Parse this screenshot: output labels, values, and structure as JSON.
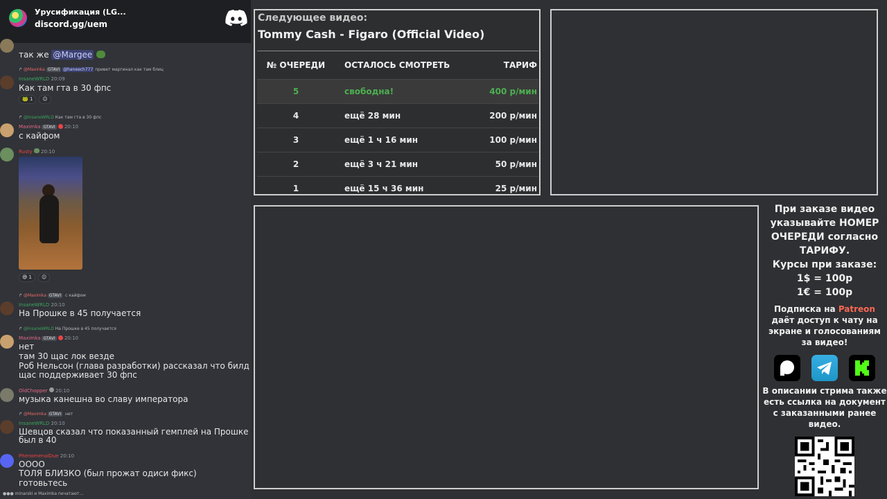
{
  "server": {
    "name": "Урусификация (LG...",
    "invite": "discord.gg/uem"
  },
  "messages": [
    {
      "text": "так же",
      "mention": "@Margee"
    },
    {
      "reply_user": "@Maxinka",
      "reply_tag": "GTAVI",
      "reply_mention": "@haneech777",
      "reply_text": "привет маргинал как там блиц",
      "user": "InsaneWRLD",
      "time": "20:09",
      "text": "Как там гта в 30 фпс",
      "reaction_count": "1"
    },
    {
      "reply_user": "@InsaneWRLD",
      "reply_text": "Как там гта в 30 фпс",
      "user": "Maximka",
      "tag": "GTAVI",
      "time": "20:10",
      "text": "с кайфом"
    },
    {
      "user": "Rusty",
      "time": "20:10",
      "reaction_count": "1"
    },
    {
      "reply_user": "@Maximka",
      "reply_tag": "GTAVI",
      "reply_text": "с кайфом",
      "user": "InsaneWRLD",
      "time": "20:10",
      "text": "На Прошке в 45 получается"
    },
    {
      "reply_user": "@InsaneWRLD",
      "reply_text": "На Прошке в 45 получается",
      "user": "Maximka",
      "tag": "GTAVI",
      "time": "20:10",
      "lines": [
        "нет",
        "там 30 щас лок везде",
        "Роб Нельсон (глава разработки) рассказал что билд",
        "щас поддерживает 30 фпс"
      ]
    },
    {
      "user": "OldChopper",
      "time": "20:10",
      "text": "музыка канешна во славу императора"
    },
    {
      "reply_user": "@Maximka",
      "reply_tag": "GTAVI",
      "reply_text": "нет",
      "user": "InsaneWRLD",
      "time": "20:10",
      "lines": [
        "Шевцов сказал что показанный гемплей на Прошке",
        "был в 40"
      ]
    },
    {
      "user": "PhenomenalDue",
      "time": "20:10",
      "lines": [
        "ОООО",
        "ТОЛЯ БЛИЗКО (был прожат одиси фикс)",
        "готовьтесь"
      ]
    }
  ],
  "typing": "minarski и Maximka печатают...",
  "queue": {
    "next_label": "Следующее видео:",
    "next_title": "Tommy Cash - Figaro (Official Video)",
    "headers": [
      "№ ОЧЕРЕДИ",
      "ОСТАЛОСЬ СМОТРЕТЬ",
      "ТАРИФ"
    ],
    "rows": [
      {
        "n": "5",
        "left": "свободна!",
        "price": "400 р/мин"
      },
      {
        "n": "4",
        "left": "ещё 28 мин",
        "price": "200 р/мин"
      },
      {
        "n": "3",
        "left": "ещё 1 ч 16 мин",
        "price": "100 р/мин"
      },
      {
        "n": "2",
        "left": "ещё 3 ч 21 мин",
        "price": "50 р/мин"
      },
      {
        "n": "1",
        "left": "ещё 15 ч 36 мин",
        "price": "25 р/мин"
      }
    ]
  },
  "info": {
    "order_lines": [
      "При заказе видео",
      "указывайте НОМЕР",
      "ОЧЕРЕДИ согласно",
      "ТАРИФУ."
    ],
    "rates_title": "Курсы при заказе:",
    "rates": [
      "1$ = 100р",
      "1€ = 100р"
    ],
    "sub_pre": "Подписка на",
    "sub_link": "Patreon",
    "sub_lines": [
      "даёт доступ к чату на",
      "экране и голосованиям",
      "за видео!"
    ],
    "desc_lines": [
      "В описании стрима также",
      "есть ссылка на документ",
      "с заказанными ранее",
      "видео."
    ],
    "icons": [
      "patreon-icon",
      "telegram-icon",
      "kick-icon"
    ]
  },
  "colors": {
    "green": "#4caf50",
    "patreon": "#f96854",
    "discord": "#5865f2"
  }
}
